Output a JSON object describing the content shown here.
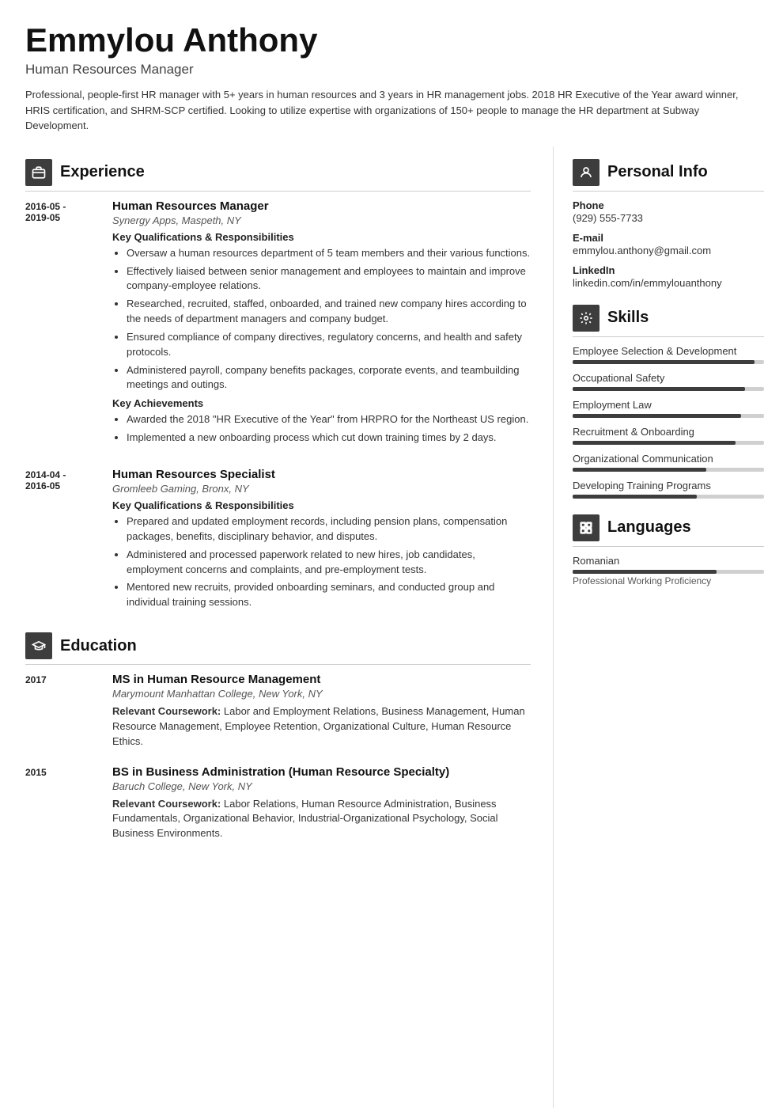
{
  "header": {
    "name": "Emmylou Anthony",
    "title": "Human Resources Manager",
    "summary": "Professional, people-first HR manager with 5+ years in human resources and 3 years in HR management jobs. 2018 HR Executive of the Year award winner, HRIS certification, and SHRM-SCP certified. Looking to utilize expertise with organizations of 150+ people to manage the HR department at Subway Development."
  },
  "sections": {
    "experience_label": "Experience",
    "education_label": "Education",
    "personal_info_label": "Personal Info",
    "skills_label": "Skills",
    "languages_label": "Languages"
  },
  "experience": [
    {
      "date": "2016-05 -\n2019-05",
      "title": "Human Resources Manager",
      "company": "Synergy Apps, Maspeth, NY",
      "qualifications_heading": "Key Qualifications & Responsibilities",
      "qualifications": [
        "Oversaw a human resources department of 5 team members and their various functions.",
        "Effectively liaised between senior management and employees to maintain and improve company-employee relations.",
        "Researched, recruited, staffed, onboarded, and trained new company hires according to the needs of department managers and company budget.",
        "Ensured compliance of company directives, regulatory concerns, and health and safety protocols.",
        "Administered payroll, company benefits packages, corporate events, and teambuilding meetings and outings."
      ],
      "achievements_heading": "Key Achievements",
      "achievements": [
        "Awarded the 2018 \"HR Executive of the Year\" from HRPRO for the Northeast US region.",
        "Implemented a new onboarding process which cut down training times by 2 days."
      ]
    },
    {
      "date": "2014-04 -\n2016-05",
      "title": "Human Resources Specialist",
      "company": "Gromleeb Gaming, Bronx, NY",
      "qualifications_heading": "Key Qualifications & Responsibilities",
      "qualifications": [
        "Prepared and updated employment records, including pension plans, compensation packages, benefits, disciplinary behavior, and disputes.",
        "Administered and processed paperwork related to new hires, job candidates, employment concerns and complaints, and pre-employment tests.",
        "Mentored new recruits, provided onboarding seminars, and conducted group and individual training sessions."
      ],
      "achievements_heading": null,
      "achievements": []
    }
  ],
  "education": [
    {
      "year": "2017",
      "degree": "MS in Human Resource Management",
      "school": "Marymount Manhattan College, New York, NY",
      "coursework_label": "Relevant Coursework:",
      "coursework": "Labor and Employment Relations, Business Management, Human Resource Management, Employee Retention, Organizational Culture, Human Resource Ethics."
    },
    {
      "year": "2015",
      "degree": "BS in Business Administration (Human Resource Specialty)",
      "school": "Baruch College, New York, NY",
      "coursework_label": "Relevant Coursework:",
      "coursework": "Labor Relations, Human Resource Administration, Business Fundamentals, Organizational Behavior, Industrial-Organizational Psychology, Social Business Environments."
    }
  ],
  "personal_info": {
    "phone_label": "Phone",
    "phone": "(929) 555-7733",
    "email_label": "E-mail",
    "email": "emmylou.anthony@gmail.com",
    "linkedin_label": "LinkedIn",
    "linkedin": "linkedin.com/in/emmylouanthony"
  },
  "skills": [
    {
      "name": "Employee Selection &\nDevelopment",
      "level": 95
    },
    {
      "name": "Occupational Safety",
      "level": 90
    },
    {
      "name": "Employment Law",
      "level": 88
    },
    {
      "name": "Recruitment & Onboarding",
      "level": 85
    },
    {
      "name": "Organizational Communication",
      "level": 70
    },
    {
      "name": "Developing Training Programs",
      "level": 65
    }
  ],
  "languages": [
    {
      "name": "Romanian",
      "proficiency": "Professional Working Proficiency",
      "level": 75
    }
  ]
}
